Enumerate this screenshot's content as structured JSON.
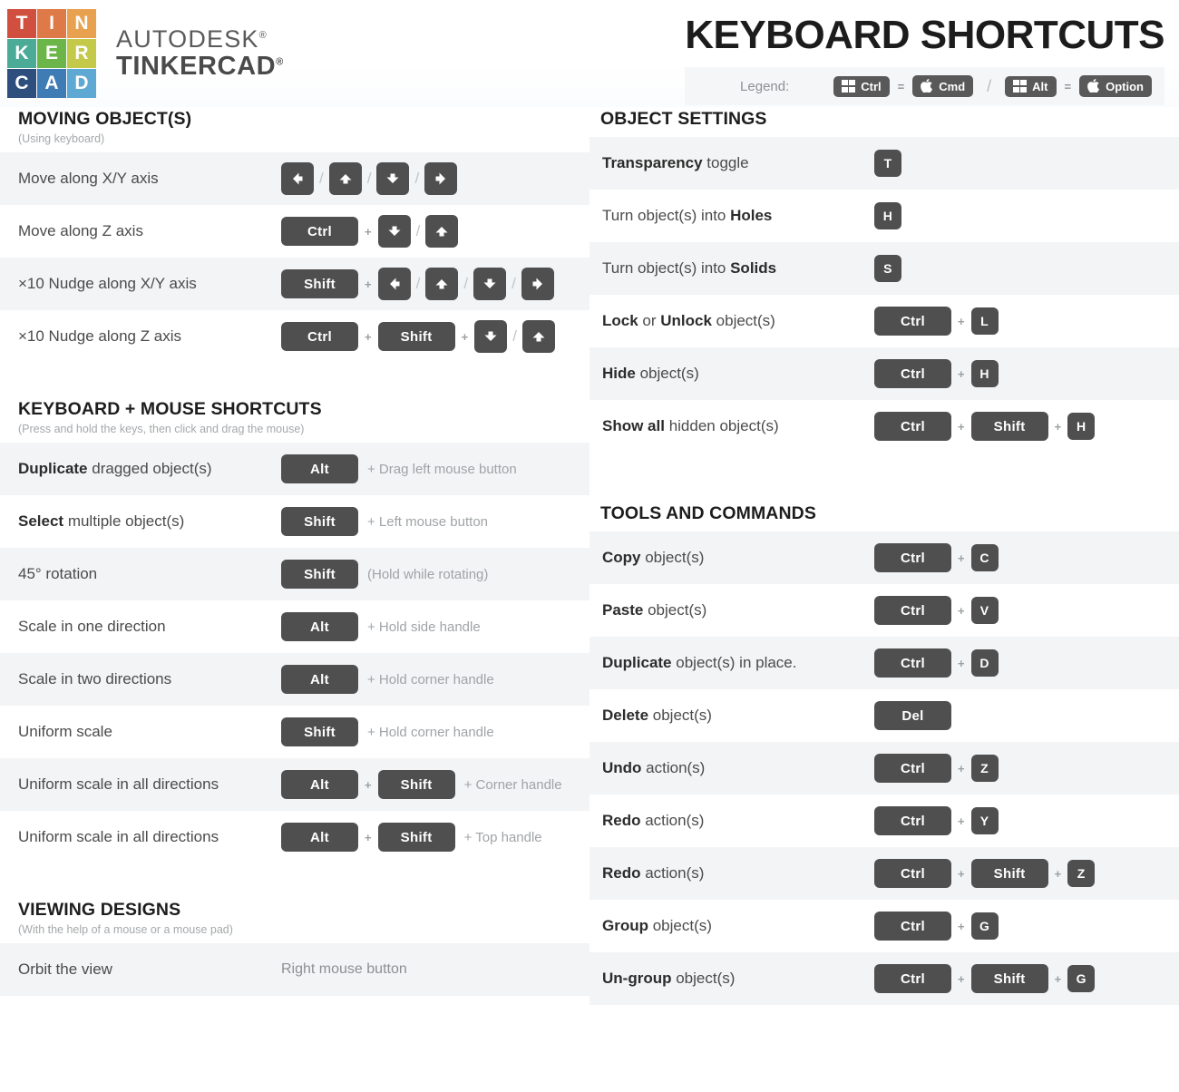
{
  "brand": {
    "logo_letters": [
      "T",
      "I",
      "N",
      "K",
      "E",
      "R",
      "C",
      "A",
      "D"
    ],
    "logo_colors": [
      "#d04f3f",
      "#de7a48",
      "#e8a24f",
      "#4cab96",
      "#6cb548",
      "#c4c94a",
      "#2e4e7e",
      "#3f7bb5",
      "#5ea8d4"
    ],
    "line1": "AUTODESK",
    "line2": "TINKERCAD",
    "registered": "®"
  },
  "header": {
    "title": "KEYBOARD SHORTCUTS",
    "legend_label": "Legend:",
    "legend": [
      {
        "icon": "windows-icon",
        "label": "Ctrl"
      },
      {
        "icon": "apple-icon",
        "label": "Cmd"
      },
      {
        "icon": "windows-icon",
        "label": "Alt"
      },
      {
        "icon": "apple-icon",
        "label": "Option"
      }
    ],
    "equals": "=",
    "separator": "/"
  },
  "sections": {
    "moving": {
      "title": "MOVING OBJECT(S)",
      "subtitle": "(Using keyboard)",
      "rows": [
        {
          "label_pre": "",
          "label_bold": "",
          "label_post": "Move along X/Y axis",
          "keys": [
            {
              "type": "arrow",
              "dir": "left"
            },
            {
              "type": "slash"
            },
            {
              "type": "arrow",
              "dir": "up"
            },
            {
              "type": "slash"
            },
            {
              "type": "arrow",
              "dir": "down"
            },
            {
              "type": "slash"
            },
            {
              "type": "arrow",
              "dir": "right"
            }
          ]
        },
        {
          "label_pre": "",
          "label_bold": "",
          "label_post": "Move along Z axis",
          "keys": [
            {
              "type": "wide",
              "text": "Ctrl"
            },
            {
              "type": "plus"
            },
            {
              "type": "arrow",
              "dir": "down"
            },
            {
              "type": "slash"
            },
            {
              "type": "arrow",
              "dir": "up"
            }
          ]
        },
        {
          "label_pre": "",
          "label_bold": "",
          "label_post": "×10 Nudge along X/Y axis",
          "keys": [
            {
              "type": "wide",
              "text": "Shift"
            },
            {
              "type": "plus"
            },
            {
              "type": "arrow",
              "dir": "left"
            },
            {
              "type": "slash"
            },
            {
              "type": "arrow",
              "dir": "up"
            },
            {
              "type": "slash"
            },
            {
              "type": "arrow",
              "dir": "down"
            },
            {
              "type": "slash"
            },
            {
              "type": "arrow",
              "dir": "right"
            }
          ]
        },
        {
          "label_pre": "",
          "label_bold": "",
          "label_post": "×10 Nudge along Z axis",
          "keys": [
            {
              "type": "wide",
              "text": "Ctrl"
            },
            {
              "type": "plus"
            },
            {
              "type": "wide",
              "text": "Shift"
            },
            {
              "type": "plus"
            },
            {
              "type": "arrow",
              "dir": "down"
            },
            {
              "type": "slash"
            },
            {
              "type": "arrow",
              "dir": "up"
            }
          ]
        }
      ]
    },
    "keyboard_mouse": {
      "title": "KEYBOARD + MOUSE SHORTCUTS",
      "subtitle": "(Press and hold the keys, then click and drag the mouse)",
      "rows": [
        {
          "label_bold": "Duplicate",
          "label_post": " dragged object(s)",
          "keys": [
            {
              "type": "wide",
              "text": "Alt"
            }
          ],
          "note": "+ Drag left mouse button"
        },
        {
          "label_bold": "Select",
          "label_post": " multiple object(s)",
          "keys": [
            {
              "type": "wide",
              "text": "Shift"
            }
          ],
          "note": "+ Left mouse button"
        },
        {
          "label_bold": "",
          "label_post": "45° rotation",
          "keys": [
            {
              "type": "wide",
              "text": "Shift"
            }
          ],
          "note": "(Hold while rotating)"
        },
        {
          "label_bold": "",
          "label_post": "Scale in one direction",
          "keys": [
            {
              "type": "wide",
              "text": "Alt"
            }
          ],
          "note": "+ Hold side handle"
        },
        {
          "label_bold": "",
          "label_post": "Scale in two directions",
          "keys": [
            {
              "type": "wide",
              "text": "Alt"
            }
          ],
          "note": "+ Hold corner handle"
        },
        {
          "label_bold": "",
          "label_post": "Uniform scale",
          "keys": [
            {
              "type": "wide",
              "text": "Shift"
            }
          ],
          "note": "+ Hold corner handle"
        },
        {
          "label_bold": "",
          "label_post": "Uniform scale in all directions",
          "keys": [
            {
              "type": "wide",
              "text": "Alt"
            },
            {
              "type": "plus"
            },
            {
              "type": "wide",
              "text": "Shift"
            }
          ],
          "note": "+ Corner handle"
        },
        {
          "label_bold": "",
          "label_post": "Uniform scale in all directions",
          "keys": [
            {
              "type": "wide",
              "text": "Alt"
            },
            {
              "type": "plus"
            },
            {
              "type": "wide",
              "text": "Shift"
            }
          ],
          "note": "+ Top handle"
        }
      ]
    },
    "viewing": {
      "title": "VIEWING DESIGNS",
      "subtitle": "(With the help of a mouse or a mouse pad)",
      "rows": [
        {
          "label_bold": "",
          "label_post": "Orbit the view",
          "keys": [],
          "mouse_note": "Right mouse button"
        }
      ]
    },
    "object_settings": {
      "title": "OBJECT SETTINGS",
      "subtitle": "",
      "rows": [
        {
          "label_bold": "Transparency",
          "label_post": " toggle",
          "keys": [
            {
              "type": "letter",
              "text": "T"
            }
          ]
        },
        {
          "label_pre": "Turn object(s) into ",
          "label_bold": "Holes",
          "label_post": "",
          "keys": [
            {
              "type": "letter",
              "text": "H"
            }
          ]
        },
        {
          "label_pre": "Turn object(s) into ",
          "label_bold": "Solids",
          "label_post": "",
          "keys": [
            {
              "type": "letter",
              "text": "S"
            }
          ]
        },
        {
          "label_bold": "Lock",
          "label_mid": " or ",
          "label_bold2": "Unlock",
          "label_post": " object(s)",
          "keys": [
            {
              "type": "wide",
              "text": "Ctrl"
            },
            {
              "type": "plus"
            },
            {
              "type": "letter",
              "text": "L"
            }
          ]
        },
        {
          "label_bold": "Hide",
          "label_post": " object(s)",
          "keys": [
            {
              "type": "wide",
              "text": "Ctrl"
            },
            {
              "type": "plus"
            },
            {
              "type": "letter",
              "text": "H"
            }
          ]
        },
        {
          "label_bold": "Show all",
          "label_post": " hidden object(s)",
          "keys": [
            {
              "type": "wide",
              "text": "Ctrl"
            },
            {
              "type": "plus"
            },
            {
              "type": "wide",
              "text": "Shift"
            },
            {
              "type": "plus"
            },
            {
              "type": "letter",
              "text": "H"
            }
          ]
        }
      ]
    },
    "tools": {
      "title": "TOOLS AND COMMANDS",
      "subtitle": "",
      "rows": [
        {
          "label_bold": "Copy",
          "label_post": " object(s)",
          "keys": [
            {
              "type": "wide",
              "text": "Ctrl"
            },
            {
              "type": "plus"
            },
            {
              "type": "letter",
              "text": "C"
            }
          ]
        },
        {
          "label_bold": "Paste",
          "label_post": " object(s)",
          "keys": [
            {
              "type": "wide",
              "text": "Ctrl"
            },
            {
              "type": "plus"
            },
            {
              "type": "letter",
              "text": "V"
            }
          ]
        },
        {
          "label_bold": "Duplicate",
          "label_post": " object(s) in place.",
          "keys": [
            {
              "type": "wide",
              "text": "Ctrl"
            },
            {
              "type": "plus"
            },
            {
              "type": "letter",
              "text": "D"
            }
          ]
        },
        {
          "label_bold": "Delete",
          "label_post": " object(s)",
          "keys": [
            {
              "type": "del",
              "text": "Del"
            }
          ]
        },
        {
          "label_bold": "Undo",
          "label_post": " action(s)",
          "keys": [
            {
              "type": "wide",
              "text": "Ctrl"
            },
            {
              "type": "plus"
            },
            {
              "type": "letter",
              "text": "Z"
            }
          ]
        },
        {
          "label_bold": "Redo",
          "label_post": " action(s)",
          "keys": [
            {
              "type": "wide",
              "text": "Ctrl"
            },
            {
              "type": "plus"
            },
            {
              "type": "letter",
              "text": "Y"
            }
          ]
        },
        {
          "label_bold": "Redo",
          "label_post": " action(s)",
          "keys": [
            {
              "type": "wide",
              "text": "Ctrl"
            },
            {
              "type": "plus"
            },
            {
              "type": "wide",
              "text": "Shift"
            },
            {
              "type": "plus"
            },
            {
              "type": "letter",
              "text": "Z"
            }
          ]
        },
        {
          "label_bold": "Group",
          "label_post": " object(s)",
          "keys": [
            {
              "type": "wide",
              "text": "Ctrl"
            },
            {
              "type": "plus"
            },
            {
              "type": "letter",
              "text": "G"
            }
          ]
        },
        {
          "label_bold": "Un-group",
          "label_post": " object(s)",
          "keys": [
            {
              "type": "wide",
              "text": "Ctrl"
            },
            {
              "type": "plus"
            },
            {
              "type": "wide",
              "text": "Shift"
            },
            {
              "type": "plus"
            },
            {
              "type": "letter",
              "text": "G"
            }
          ]
        }
      ]
    }
  },
  "colors": {
    "key_bg": "#4f4f50",
    "row_alt_bg": "#f2f4f5",
    "legend_bg": "#f4f6f7",
    "title": "#1c1c1c",
    "muted": "#a4a8ab"
  }
}
